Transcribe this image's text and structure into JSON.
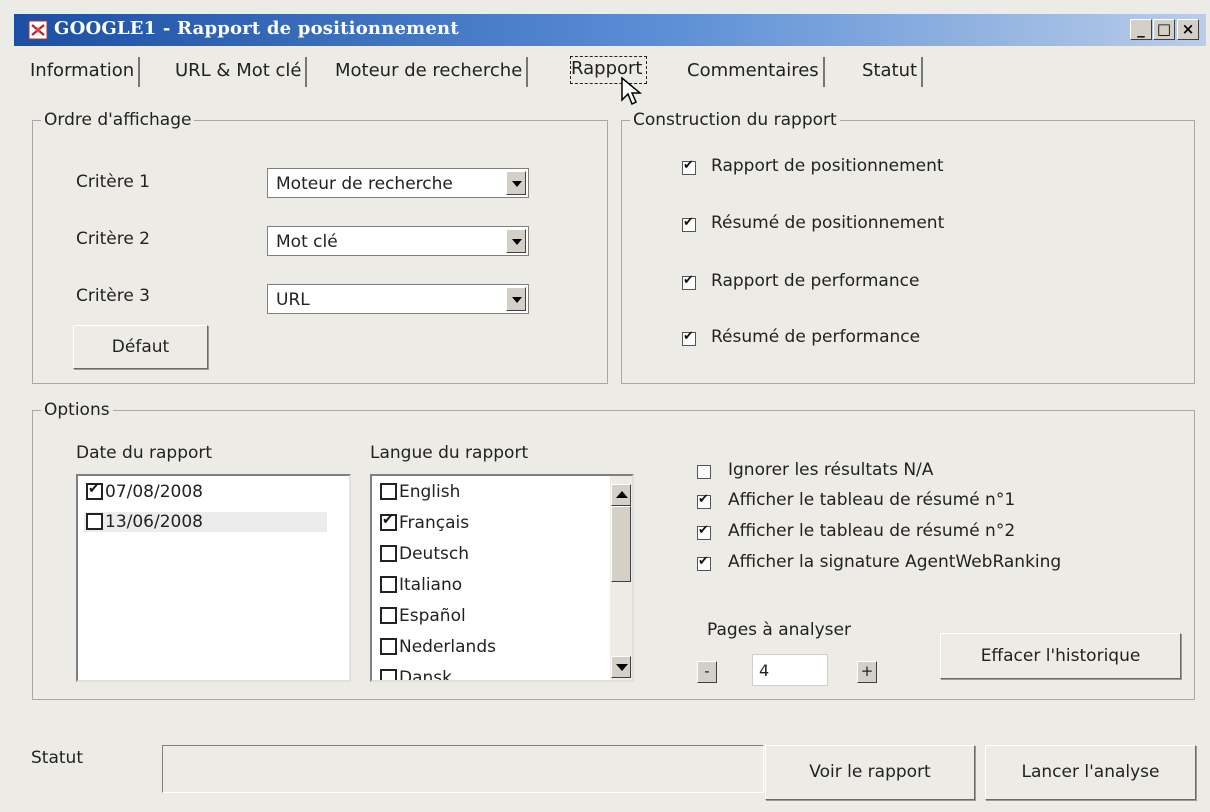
{
  "window": {
    "title": "GOOGLE1 - Rapport de positionnement",
    "minimize": "_",
    "maximize": "□",
    "close": "×"
  },
  "tabs": [
    {
      "label": "Information"
    },
    {
      "label": "URL & Mot clé"
    },
    {
      "label": "Moteur de recherche"
    },
    {
      "label": "Rapport",
      "active": true
    },
    {
      "label": "Commentaires"
    },
    {
      "label": "Statut"
    }
  ],
  "display_order": {
    "legend": "Ordre d'affichage",
    "criteria": [
      {
        "label": "Critère 1",
        "value": "Moteur de recherche"
      },
      {
        "label": "Critère 2",
        "value": "Mot clé"
      },
      {
        "label": "Critère 3",
        "value": "URL"
      }
    ],
    "default_button": "Défaut"
  },
  "report_build": {
    "legend": "Construction du rapport",
    "items": [
      {
        "label": "Rapport de positionnement",
        "checked": true
      },
      {
        "label": "Résumé de positionnement",
        "checked": true
      },
      {
        "label": "Rapport de performance",
        "checked": true
      },
      {
        "label": "Résumé de performance",
        "checked": true
      }
    ]
  },
  "options": {
    "legend": "Options",
    "date_label": "Date du rapport",
    "dates": [
      {
        "label": "07/08/2008",
        "checked": true
      },
      {
        "label": "13/06/2008",
        "checked": false
      }
    ],
    "language_label": "Langue du rapport",
    "languages": [
      {
        "label": "English",
        "checked": false
      },
      {
        "label": "Français",
        "checked": true
      },
      {
        "label": "Deutsch",
        "checked": false
      },
      {
        "label": "Italiano",
        "checked": false
      },
      {
        "label": "Español",
        "checked": false
      },
      {
        "label": "Nederlands",
        "checked": false
      },
      {
        "label": "Dansk",
        "checked": false
      }
    ],
    "flags": [
      {
        "label": "Ignorer les résultats N/A",
        "checked": false
      },
      {
        "label": "Afficher le tableau de résumé n°1",
        "checked": true
      },
      {
        "label": "Afficher le tableau de résumé n°2",
        "checked": true
      },
      {
        "label": "Afficher la signature AgentWebRanking",
        "checked": true
      }
    ],
    "pages_label": "Pages à analyser",
    "pages_value": "4",
    "minus": "-",
    "plus": "+",
    "clear_history": "Effacer l'historique"
  },
  "footer": {
    "status_label": "Statut",
    "status_value": "",
    "view_report": "Voir le rapport",
    "run_analysis": "Lancer l'analyse"
  }
}
